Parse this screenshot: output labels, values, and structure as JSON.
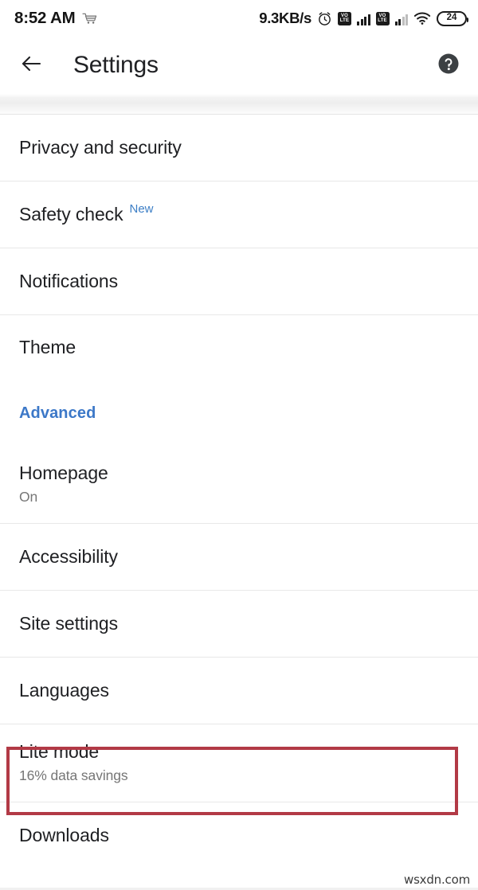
{
  "status_bar": {
    "time": "8:52 AM",
    "cart_icon": "shopping-cart-icon",
    "network_speed": "9.3KB/s",
    "alarm_icon": "alarm-clock-icon",
    "volte_label_top": "VO",
    "volte_label_bottom": "LTE",
    "wifi_icon": "wifi-icon",
    "battery_level": "24"
  },
  "app_bar": {
    "back_icon": "back-arrow-icon",
    "title": "Settings",
    "help_icon": "help-circle-icon"
  },
  "colors": {
    "accent_blue": "#3c78c8",
    "badge_blue": "#3d7fc6",
    "highlight_red": "#b23a46",
    "text_primary": "#202124",
    "text_secondary": "#767676",
    "divider": "#e8e8e8"
  },
  "settings": {
    "items": [
      {
        "title": "Privacy and security"
      },
      {
        "title": "Safety check",
        "badge": "New"
      },
      {
        "title": "Notifications"
      },
      {
        "title": "Theme"
      },
      {
        "title": "Advanced",
        "type": "section_header"
      },
      {
        "title": "Homepage",
        "subtitle": "On"
      },
      {
        "title": "Accessibility"
      },
      {
        "title": "Site settings"
      },
      {
        "title": "Languages"
      },
      {
        "title": "Lite mode",
        "subtitle": "16% data savings",
        "highlighted": true
      },
      {
        "title": "Downloads"
      }
    ]
  },
  "watermark": {
    "text": "wsxdn.com"
  }
}
